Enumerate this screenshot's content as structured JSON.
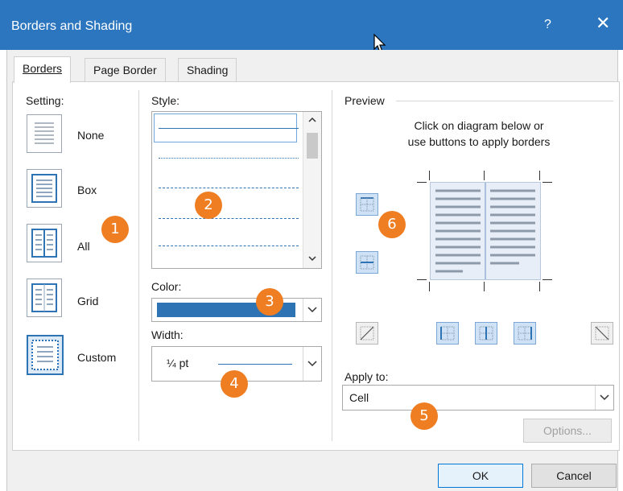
{
  "window": {
    "title": "Borders and Shading",
    "help": "?",
    "close": "✕"
  },
  "tabs": [
    {
      "label": "Borders",
      "active": true
    },
    {
      "label": "Page Border",
      "active": false
    },
    {
      "label": "Shading",
      "active": false
    }
  ],
  "setting": {
    "label": "Setting:",
    "items": [
      {
        "label": "None",
        "icon": "none-setting-icon"
      },
      {
        "label": "Box",
        "icon": "box-setting-icon"
      },
      {
        "label": "All",
        "icon": "all-setting-icon"
      },
      {
        "label": "Grid",
        "icon": "grid-setting-icon"
      },
      {
        "label": "Custom",
        "icon": "custom-setting-icon"
      }
    ]
  },
  "style": {
    "label": "Style:",
    "line_styles": [
      "solid",
      "dotted",
      "dashed-fine",
      "dashed",
      "dash-dot"
    ]
  },
  "color": {
    "label": "Color:",
    "value_color": "#2e74b5"
  },
  "width": {
    "label": "Width:",
    "value": "¼ pt"
  },
  "preview": {
    "label": "Preview",
    "hint_line1": "Click on diagram below or",
    "hint_line2": "use buttons to apply borders"
  },
  "apply_to": {
    "label": "Apply to:",
    "value": "Cell"
  },
  "buttons": {
    "options": "Options...",
    "ok": "OK",
    "cancel": "Cancel"
  },
  "callouts": [
    "1",
    "2",
    "3",
    "4",
    "5",
    "6"
  ],
  "colors": {
    "titlebar": "#2b76bf",
    "callout": "#ef7d22",
    "accent": "#2e74b5"
  }
}
